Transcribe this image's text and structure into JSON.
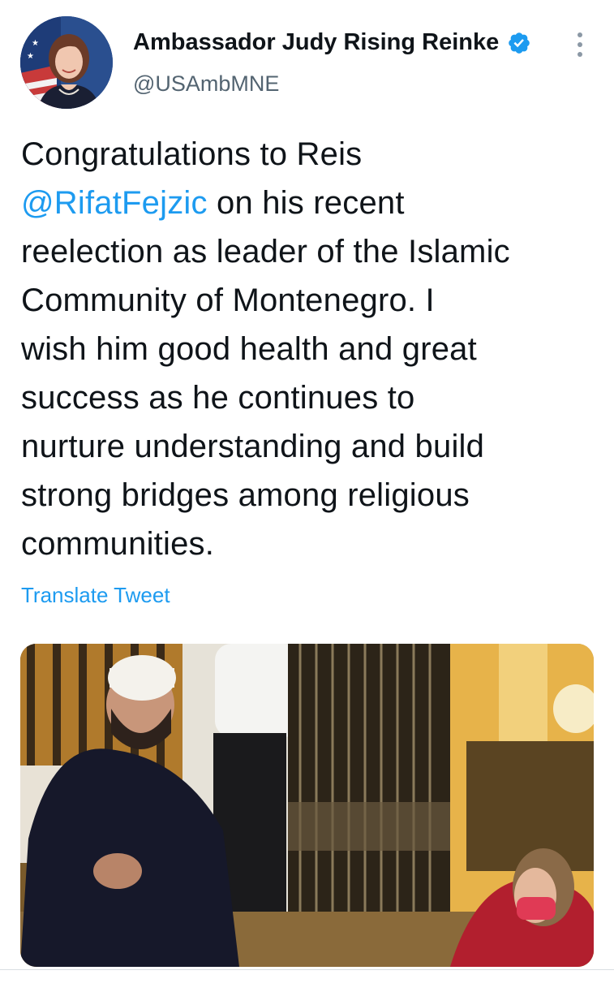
{
  "author": {
    "display_name": "Ambassador Judy Rising Reinke",
    "handle": "@USAmbMNE",
    "verified": true
  },
  "tweet": {
    "text_lines": [
      [
        {
          "text": "Congratulations to Reis",
          "type": "plain"
        }
      ],
      [
        {
          "text": "@RifatFejzic",
          "type": "mention"
        },
        {
          "text": " on his recent",
          "type": "plain"
        }
      ],
      [
        {
          "text": "reelection as leader of the Islamic",
          "type": "plain"
        }
      ],
      [
        {
          "text": "Community of Montenegro. I",
          "type": "plain"
        }
      ],
      [
        {
          "text": "wish him good health and great",
          "type": "plain"
        }
      ],
      [
        {
          "text": "success as he continues to",
          "type": "plain"
        }
      ],
      [
        {
          "text": "nurture understanding and build",
          "type": "plain"
        }
      ],
      [
        {
          "text": "strong bridges among religious",
          "type": "plain"
        }
      ],
      [
        {
          "text": "communities.",
          "type": "plain"
        }
      ]
    ],
    "translate_label": "Translate Tweet"
  },
  "icons": {
    "verified": "verified-badge-icon",
    "more": "more-options-icon"
  },
  "colors": {
    "accent": "#1d9bf0",
    "text_primary": "#0f1419",
    "text_secondary": "#536471"
  }
}
